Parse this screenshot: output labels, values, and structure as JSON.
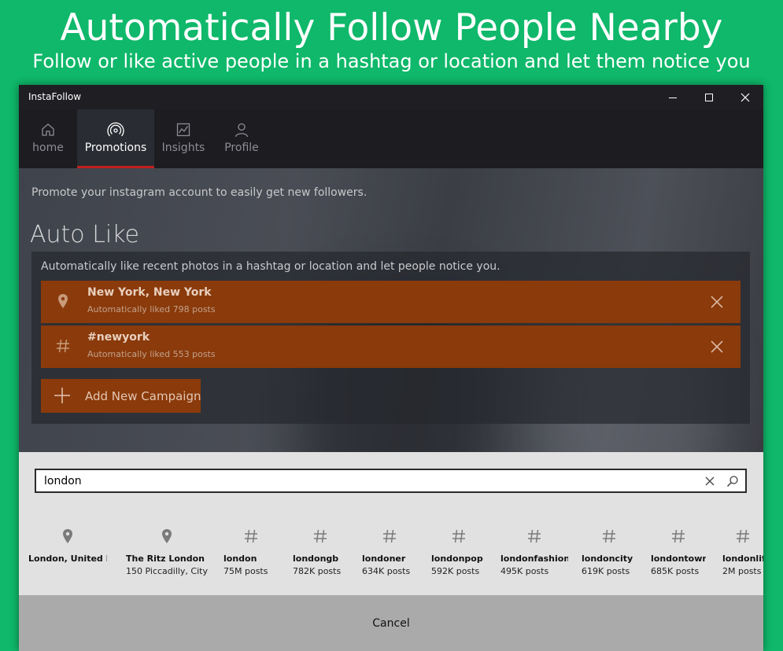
{
  "banner": {
    "title": "Automatically Follow People Nearby",
    "subtitle": "Follow or like active people in a hashtag or location and let them notice you"
  },
  "window": {
    "title": "InstaFollow",
    "controls": [
      "minimize-icon",
      "maximize-icon",
      "close-icon"
    ]
  },
  "nav": {
    "items": [
      {
        "label": "home",
        "icon": "home-icon",
        "active": false
      },
      {
        "label": "Promotions",
        "icon": "broadcast-icon",
        "active": true
      },
      {
        "label": "Insights",
        "icon": "chart-icon",
        "active": false
      },
      {
        "label": "Profile",
        "icon": "person-icon",
        "active": false
      }
    ]
  },
  "colors": {
    "accent_green": "#0fb86a",
    "campaign_orange": "#8a3a0b",
    "nav_active_underline": "#c2201d"
  },
  "main": {
    "promote_text": "Promote your instagram account to easily get new followers.",
    "section_title": "Auto Like",
    "description": "Automatically like recent photos in a hashtag or location and let people notice you.",
    "campaigns": [
      {
        "title": "New York, New York",
        "subtitle": "Automatically liked 798 posts",
        "icon": "location-pin-icon"
      },
      {
        "title": "#newyork",
        "subtitle": "Automatically liked 553 posts",
        "icon": "hashtag-icon"
      }
    ],
    "add_campaign_label": "Add New Campaign"
  },
  "search": {
    "value": "london",
    "clear_icon": "clear-icon",
    "submit_icon": "search-icon",
    "results": [
      {
        "type": "location",
        "icon": "location-pin-icon",
        "name": "London, United Kingdom",
        "sub": ""
      },
      {
        "type": "location",
        "icon": "location-pin-icon",
        "name": "The Ritz London",
        "sub": "150 Piccadilly, City"
      },
      {
        "type": "hashtag",
        "icon": "hashtag-icon",
        "name": "london",
        "sub": "75M posts"
      },
      {
        "type": "hashtag",
        "icon": "hashtag-icon",
        "name": "londongb",
        "sub": "782K posts"
      },
      {
        "type": "hashtag",
        "icon": "hashtag-icon",
        "name": "londoner",
        "sub": "634K posts"
      },
      {
        "type": "hashtag",
        "icon": "hashtag-icon",
        "name": "londonpop",
        "sub": "592K posts"
      },
      {
        "type": "hashtag",
        "icon": "hashtag-icon",
        "name": "londonfashion",
        "sub": "495K posts"
      },
      {
        "type": "hashtag",
        "icon": "hashtag-icon",
        "name": "londoncity",
        "sub": "619K posts"
      },
      {
        "type": "hashtag",
        "icon": "hashtag-icon",
        "name": "londontown",
        "sub": "685K posts"
      },
      {
        "type": "hashtag",
        "icon": "hashtag-icon",
        "name": "londonlife",
        "sub": "2M posts"
      }
    ]
  },
  "dialog": {
    "cancel_label": "Cancel"
  }
}
